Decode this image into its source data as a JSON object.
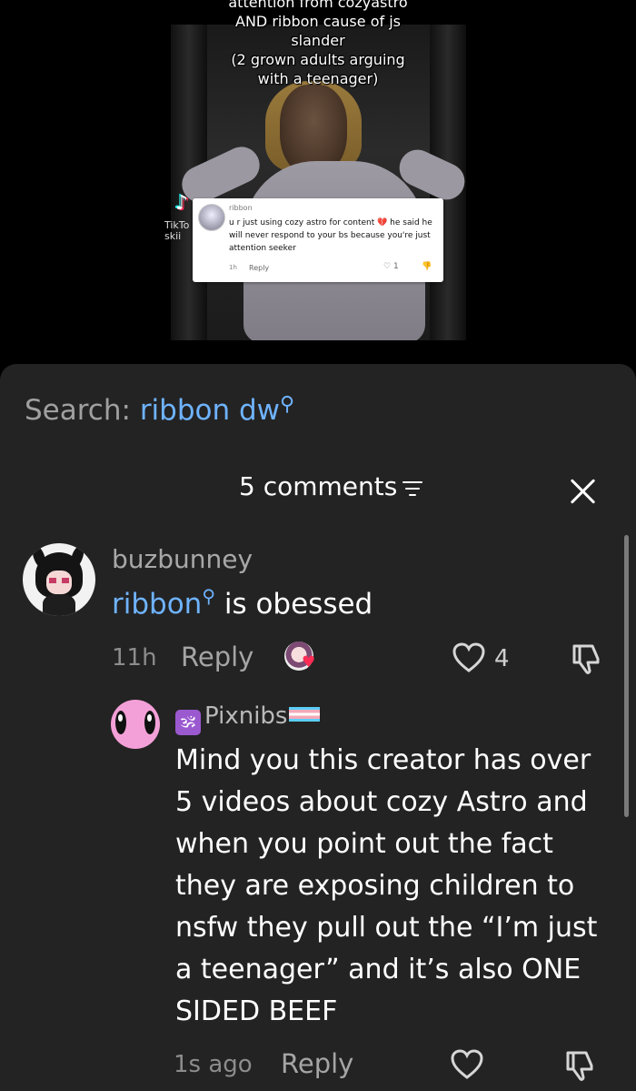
{
  "video": {
    "caption_lines": [
      "attention from cozyastro",
      "AND ribbon cause of js",
      "slander",
      "(2 grown adults arguing",
      "with a teenager)"
    ],
    "watermark_text": "TikTo",
    "watermark_handle": "skii",
    "reply_card": {
      "username": "ribbon",
      "text": "u r just using cozy astro for content 💔 he said he will never respond to your bs because you're just attention seeker",
      "time": "1h",
      "reply_label": "Reply",
      "like_count": "1"
    }
  },
  "search": {
    "prefix": "Search:",
    "term": "ribbon dw"
  },
  "comments_header": {
    "count_label": "5 comments"
  },
  "comments": [
    {
      "username": "buzbunney",
      "mention": "ribbon",
      "text": " is obessed",
      "time": "11h",
      "reply_label": "Reply",
      "like_count": "4",
      "creator_liked": true
    },
    {
      "username": "Pixnibs",
      "badge": "🕉",
      "text": "Mind you this creator has over 5 videos about cozy Astro and when you point out the fact they are exposing children to nsfw they pull out the “I’m just a teenager” and it’s also ONE SIDED BEEF",
      "time": "1s ago",
      "reply_label": "Reply"
    }
  ],
  "colors": {
    "sheet_bg": "#232323",
    "link_blue": "#6fb3ff",
    "creator_heart": "#ff2c55"
  }
}
